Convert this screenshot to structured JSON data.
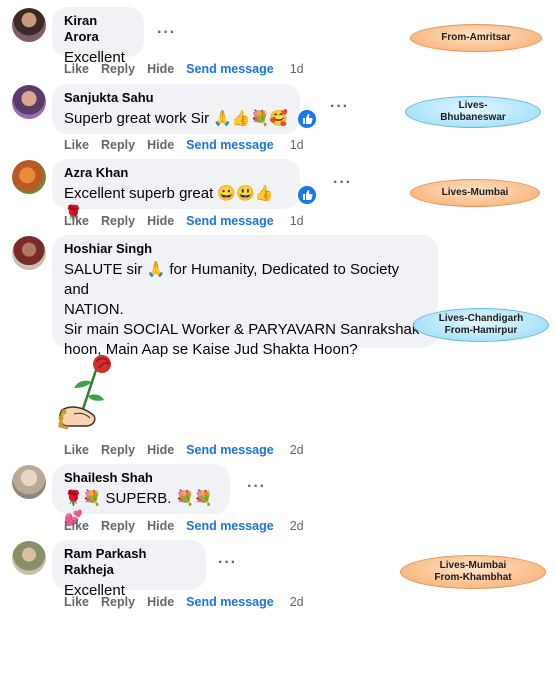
{
  "comments": [
    {
      "author": "Kiran Arora",
      "text": "Excellent",
      "time": "1d"
    },
    {
      "author": "Sanjukta Sahu",
      "text": "Superb great work Sir 🙏👍💐🥰",
      "time": "1d"
    },
    {
      "author": "Azra Khan",
      "text": "Excellent superb great 😀😃👍🌹",
      "time": "1d"
    },
    {
      "author": "Hoshiar Singh",
      "lines": [
        "SALUTE sir 🙏 for Humanity, Dedicated to Society and",
        "NATION.",
        "Sir main SOCIAL Worker & PARYAVARN Sanrakshak",
        "hoon, Main Aap se Kaise Jud Shakta Hoon?"
      ],
      "time": "2d"
    },
    {
      "author": "Shailesh Shah",
      "text": "🌹💐 SUPERB. 💐💐💕",
      "time": "2d"
    },
    {
      "author": "Ram Parkash Rakheja",
      "text": "Excellent",
      "time": "2d"
    }
  ],
  "actions": {
    "like": "Like",
    "reply": "Reply",
    "hide": "Hide",
    "send": "Send message"
  },
  "more": "···",
  "callouts": [
    {
      "lines": [
        "From-Amritsar"
      ],
      "style": "orange"
    },
    {
      "lines": [
        "Lives-",
        "Bhubaneswar"
      ],
      "style": "blue"
    },
    {
      "lines": [
        "Lives-Mumbai"
      ],
      "style": "orange"
    },
    {
      "lines": [
        "Lives-Chandigarh",
        "From-Hamirpur"
      ],
      "style": "blue"
    },
    {
      "lines": [
        "Lives-Mumbai",
        "From-Khambhat"
      ],
      "style": "orange"
    }
  ],
  "colors": {
    "link": "#1b74e4",
    "muted": "#65676b",
    "bubble": "#f0f2f5",
    "like_badge": "#1877f2"
  }
}
